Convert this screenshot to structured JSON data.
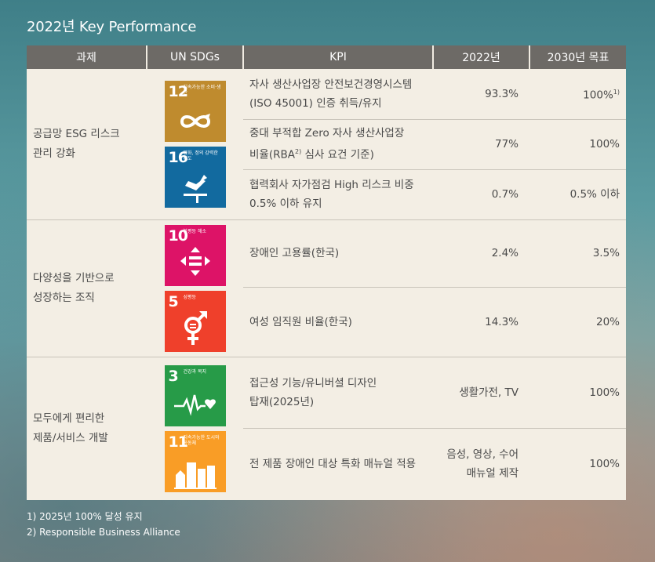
{
  "title": "2022년 Key Performance",
  "headers": {
    "task": "과제",
    "sdgs": "UN SDGs",
    "kpi": "KPI",
    "y2022": "2022년",
    "target": "2030년 목표"
  },
  "groups": [
    {
      "task": [
        "공급망 ESG 리스크",
        "관리 강화"
      ],
      "sdgs": [
        {
          "num": "12",
          "label": "지속가능한 소비·생산",
          "icon": "infinity-icon",
          "color": "#bf8b2e"
        },
        {
          "num": "16",
          "label": "평화, 정의 강력한 제도",
          "icon": "dove-icon",
          "color": "#126a9f"
        }
      ],
      "rows": [
        {
          "kpi": [
            "자사 생산사업장 안전보건경영시스템",
            "(ISO 45001) 인증 취득/유지"
          ],
          "y2022": "93.3%",
          "target": "100%",
          "target_sup": "1)"
        },
        {
          "kpi_pre": "중대 부적합 Zero 자사 생산사업장",
          "kpi_line2a": "비율(RBA",
          "kpi_sup": "2)",
          "kpi_line2b": " 심사 요건 기준)",
          "y2022": "77%",
          "target": "100%"
        },
        {
          "kpi": [
            "협력회사 자가점검 High 리스크 비중",
            "0.5% 이하 유지"
          ],
          "y2022": "0.7%",
          "target": "0.5% 이하"
        }
      ]
    },
    {
      "task": [
        "다양성을 기반으로",
        "성장하는 조직"
      ],
      "sdgs": [
        {
          "num": "10",
          "label": "불평등 해소",
          "icon": "equality-arrows-icon",
          "color": "#dd1367"
        },
        {
          "num": "5",
          "label": "성평등",
          "icon": "gender-icon",
          "color": "#ef402b"
        }
      ],
      "rows": [
        {
          "kpi": [
            "장애인 고용률(한국)"
          ],
          "y2022": "2.4%",
          "target": "3.5%"
        },
        {
          "kpi": [
            "여성 임직원 비율(한국)"
          ],
          "y2022": "14.3%",
          "target": "20%"
        }
      ]
    },
    {
      "task": [
        "모두에게 편리한",
        "제품/서비스 개발"
      ],
      "sdgs": [
        {
          "num": "3",
          "label": "건강과 복지",
          "icon": "heartbeat-icon",
          "color": "#279b48"
        },
        {
          "num": "11",
          "label": "지속가능한 도시와 공동체",
          "icon": "city-icon",
          "color": "#f99d26"
        }
      ],
      "rows": [
        {
          "kpi": [
            "접근성 기능/유니버셜 디자인",
            "탑재(2025년)"
          ],
          "y2022": [
            "생활가전, TV"
          ],
          "target": "100%"
        },
        {
          "kpi": [
            "전 제품 장애인 대상 특화 매뉴얼 적용"
          ],
          "y2022": [
            "음성, 영상, 수어",
            "매뉴얼 제작"
          ],
          "target": "100%"
        }
      ]
    }
  ],
  "footnotes": [
    "1) 2025년 100% 달성 유지",
    "2) Responsible Business Alliance"
  ]
}
